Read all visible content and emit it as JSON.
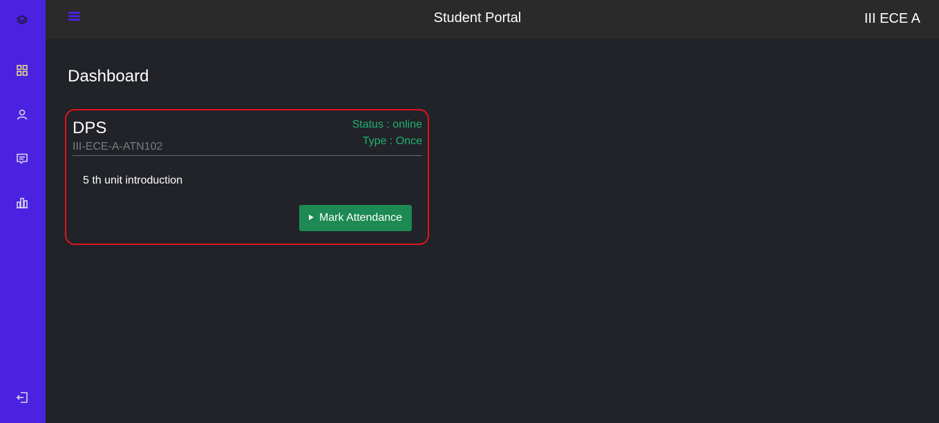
{
  "app": {
    "title": "Student Portal",
    "class_name": "III ECE A",
    "accent_color": "#4a22e0"
  },
  "sidebar": {
    "items": [
      {
        "icon": "layers-icon",
        "label": "home"
      },
      {
        "icon": "dashboard-grid-icon",
        "label": "dashboard",
        "active": true
      },
      {
        "icon": "user-icon",
        "label": "profile"
      },
      {
        "icon": "message-icon",
        "label": "messages"
      },
      {
        "icon": "bar-chart-icon",
        "label": "reports"
      },
      {
        "icon": "logout-icon",
        "label": "logout"
      }
    ]
  },
  "page": {
    "title": "Dashboard"
  },
  "card": {
    "subject": "DPS",
    "code": "III-ECE-A-ATN102",
    "status": "Status : online",
    "type": "Type : Once",
    "topic": "5 th unit introduction",
    "button_label": "Mark Attendance",
    "border_color": "#e0141c",
    "status_color": "#1fb171",
    "button_color": "#1c8a52"
  }
}
